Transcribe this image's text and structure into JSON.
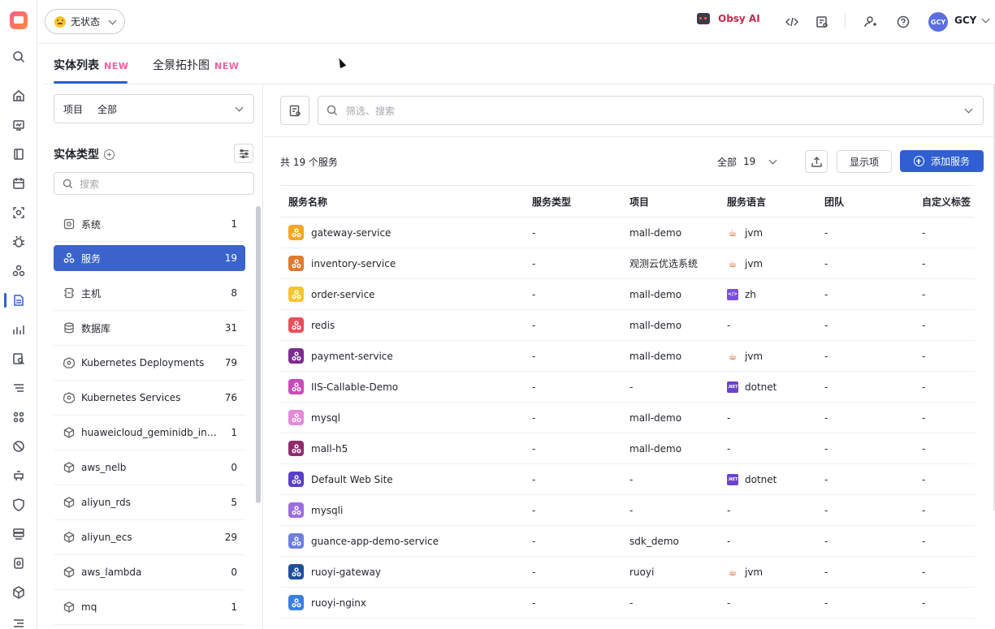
{
  "topbar": {
    "status_label": "无状态",
    "ai_label": "Obsy AI",
    "user_initials": "GCY",
    "user_name": "GCY"
  },
  "tabs": [
    {
      "label": "实体列表",
      "badge": "NEW",
      "active": true
    },
    {
      "label": "全景拓扑图",
      "badge": "NEW",
      "active": false
    }
  ],
  "sidebar": {
    "project_label": "项目",
    "project_value": "全部",
    "entity_type_title": "实体类型",
    "search_placeholder": "搜索",
    "items": [
      {
        "label": "系统",
        "count": "1",
        "icon": "system-icon"
      },
      {
        "label": "服务",
        "count": "19",
        "icon": "service-icon",
        "active": true
      },
      {
        "label": "主机",
        "count": "8",
        "icon": "host-icon"
      },
      {
        "label": "数据库",
        "count": "31",
        "icon": "database-icon"
      },
      {
        "label": "Kubernetes Deployments",
        "count": "79",
        "icon": "kubernetes-icon"
      },
      {
        "label": "Kubernetes Services",
        "count": "76",
        "icon": "kubernetes-icon"
      },
      {
        "label": "huaweicloud_geminidb_influ...",
        "count": "1",
        "icon": "cube-icon"
      },
      {
        "label": "aws_nelb",
        "count": "0",
        "icon": "cube-icon"
      },
      {
        "label": "aliyun_rds",
        "count": "5",
        "icon": "cube-icon"
      },
      {
        "label": "aliyun_ecs",
        "count": "29",
        "icon": "cube-icon"
      },
      {
        "label": "aws_lambda",
        "count": "0",
        "icon": "cube-icon"
      },
      {
        "label": "mq",
        "count": "1",
        "icon": "cube-icon"
      }
    ]
  },
  "main": {
    "filter_placeholder": "筛选、搜索",
    "total_text": "共 19 个服务",
    "scope_label": "全部",
    "scope_count": "19",
    "display_label": "显示项",
    "add_label": "添加服务",
    "columns": [
      "服务名称",
      "服务类型",
      "项目",
      "服务语言",
      "团队",
      "自定义标签"
    ],
    "rows": [
      {
        "name": "gateway-service",
        "color": "#f5a623",
        "type": "-",
        "project": "mall-demo",
        "lang": "jvm",
        "lang_icon": "jvm",
        "team": "-",
        "tags": "-"
      },
      {
        "name": "inventory-service",
        "color": "#e07a2f",
        "type": "-",
        "project": "观测云优选系统",
        "lang": "jvm",
        "lang_icon": "jvm",
        "team": "-",
        "tags": "-"
      },
      {
        "name": "order-service",
        "color": "#f7c531",
        "type": "-",
        "project": "mall-demo",
        "lang": "zh",
        "lang_icon": "zh",
        "team": "-",
        "tags": "-"
      },
      {
        "name": "redis",
        "color": "#e8505b",
        "type": "-",
        "project": "mall-demo",
        "lang": "-",
        "lang_icon": "",
        "team": "-",
        "tags": "-"
      },
      {
        "name": "payment-service",
        "color": "#7b2d8f",
        "type": "-",
        "project": "mall-demo",
        "lang": "jvm",
        "lang_icon": "jvm",
        "team": "-",
        "tags": "-"
      },
      {
        "name": "IIS-Callable-Demo",
        "color": "#c94bb8",
        "type": "-",
        "project": "-",
        "lang": "dotnet",
        "lang_icon": "dotnet",
        "team": "-",
        "tags": "-"
      },
      {
        "name": "mysql",
        "color": "#e48ad8",
        "type": "-",
        "project": "mall-demo",
        "lang": "-",
        "lang_icon": "",
        "team": "-",
        "tags": "-"
      },
      {
        "name": "mall-h5",
        "color": "#8e2c6e",
        "type": "-",
        "project": "mall-demo",
        "lang": "-",
        "lang_icon": "",
        "team": "-",
        "tags": "-"
      },
      {
        "name": "Default Web Site",
        "color": "#5a3fc9",
        "type": "-",
        "project": "-",
        "lang": "dotnet",
        "lang_icon": "dotnet",
        "team": "-",
        "tags": "-"
      },
      {
        "name": "mysqli",
        "color": "#9b6ee0",
        "type": "-",
        "project": "-",
        "lang": "-",
        "lang_icon": "",
        "team": "-",
        "tags": "-"
      },
      {
        "name": "guance-app-demo-service",
        "color": "#6d7fe0",
        "type": "-",
        "project": "sdk_demo",
        "lang": "-",
        "lang_icon": "",
        "team": "-",
        "tags": "-"
      },
      {
        "name": "ruoyi-gateway",
        "color": "#1f4f9a",
        "type": "-",
        "project": "ruoyi",
        "lang": "jvm",
        "lang_icon": "jvm",
        "team": "-",
        "tags": "-"
      },
      {
        "name": "ruoyi-nginx",
        "color": "#3a7fe0",
        "type": "-",
        "project": "-",
        "lang": "-",
        "lang_icon": "",
        "team": "-",
        "tags": "-"
      }
    ]
  }
}
